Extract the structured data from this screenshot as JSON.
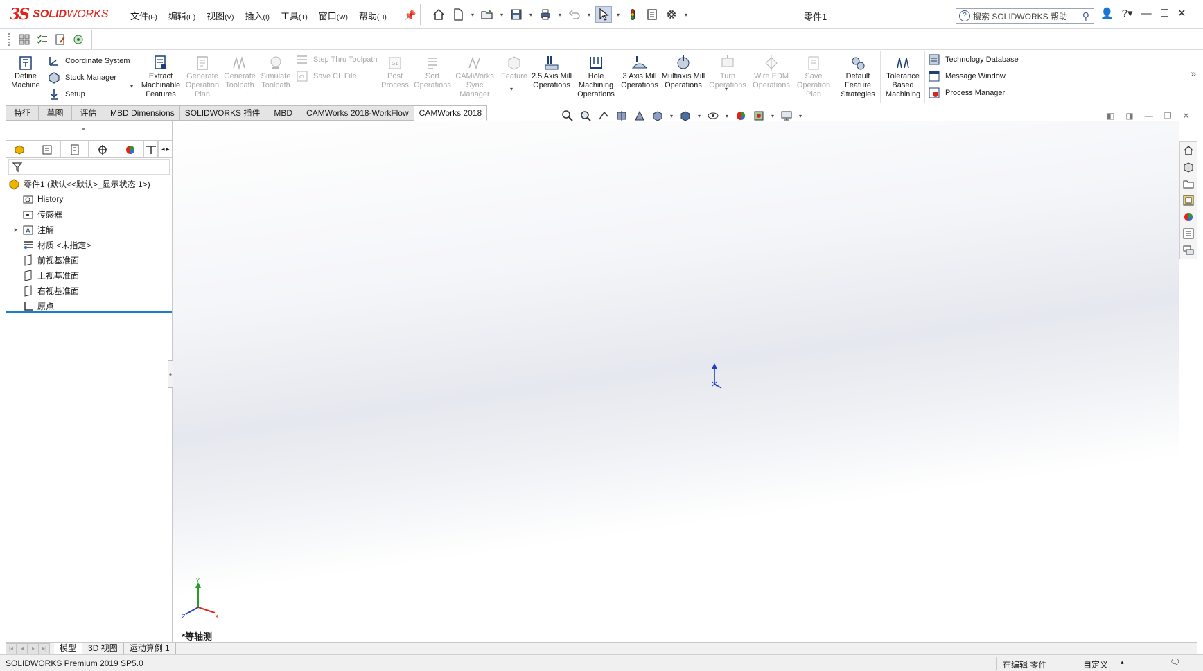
{
  "app": {
    "logo_ds": "3S",
    "logo_brand_bold": "SOLID",
    "logo_brand_rest": "WORKS",
    "document_title": "零件1"
  },
  "menu": [
    {
      "label": "文件",
      "key": "(F)"
    },
    {
      "label": "编辑",
      "key": "(E)"
    },
    {
      "label": "视图",
      "key": "(V)"
    },
    {
      "label": "插入",
      "key": "(I)"
    },
    {
      "label": "工具",
      "key": "(T)"
    },
    {
      "label": "窗口",
      "key": "(W)"
    },
    {
      "label": "帮助",
      "key": "(H)"
    }
  ],
  "help_search": {
    "placeholder": "搜索 SOLIDWORKS 帮助"
  },
  "ribbon": {
    "define_machine": "Define Machine",
    "coordinate_system": "Coordinate System",
    "stock_manager": "Stock Manager",
    "setup": "Setup",
    "extract_features": "Extract Machinable Features",
    "generate_operation_plan": "Generate Operation Plan",
    "generate_toolpath": "Generate Toolpath",
    "simulate_toolpath": "Simulate Toolpath",
    "step_thru_toolpath": "Step Thru Toolpath",
    "save_cl_file": "Save CL File",
    "post_process": "Post Process",
    "sort_operations": "Sort Operations",
    "camworks_sync_manager": "CAMWorks Sync Manager",
    "feature": "Feature",
    "axis25_mill": "2.5 Axis Mill Operations",
    "hole_machining": "Hole Machining Operations",
    "axis3_mill": "3 Axis Mill Operations",
    "multiaxis_mill": "Multiaxis Mill Operations",
    "turn_operations": "Turn Operations",
    "wire_edm": "Wire EDM Operations",
    "save_operation_plan": "Save Operation Plan",
    "default_feature_strategies": "Default Feature Strategies",
    "tolerance_based_machining": "Tolerance Based Machining",
    "technology_database": "Technology Database",
    "message_window": "Message Window",
    "process_manager": "Process Manager"
  },
  "tabs": [
    {
      "label": "特征",
      "active": false
    },
    {
      "label": "草图",
      "active": false
    },
    {
      "label": "评估",
      "active": false
    },
    {
      "label": "MBD Dimensions",
      "active": false
    },
    {
      "label": "SOLIDWORKS 插件",
      "active": false
    },
    {
      "label": "MBD",
      "active": false
    },
    {
      "label": "CAMWorks 2018-WorkFlow",
      "active": false
    },
    {
      "label": "CAMWorks 2018",
      "active": true
    }
  ],
  "tree": {
    "root": "零件1  (默认<<默认>_显示状态 1>)",
    "history": "History",
    "sensors": "传感器",
    "annotations": "注解",
    "material": "材质 <未指定>",
    "front_plane": "前视基准面",
    "top_plane": "上视基准面",
    "right_plane": "右视基准面",
    "origin": "原点"
  },
  "viewport": {
    "view_name": "*等轴测",
    "triad_x": "X",
    "triad_y": "Y",
    "triad_z": "Z"
  },
  "bottom_tabs": [
    {
      "label": "模型",
      "active": true
    },
    {
      "label": "3D 视图",
      "active": false
    },
    {
      "label": "运动算例 1",
      "active": false
    }
  ],
  "status": {
    "product": "SOLIDWORKS Premium 2019 SP5.0",
    "mode": "在编辑 零件",
    "units": "自定义"
  },
  "colors": {
    "brand_red": "#e2231a",
    "rollback_bar": "#1f7bd0",
    "origin_blue": "#1f3fc8"
  }
}
